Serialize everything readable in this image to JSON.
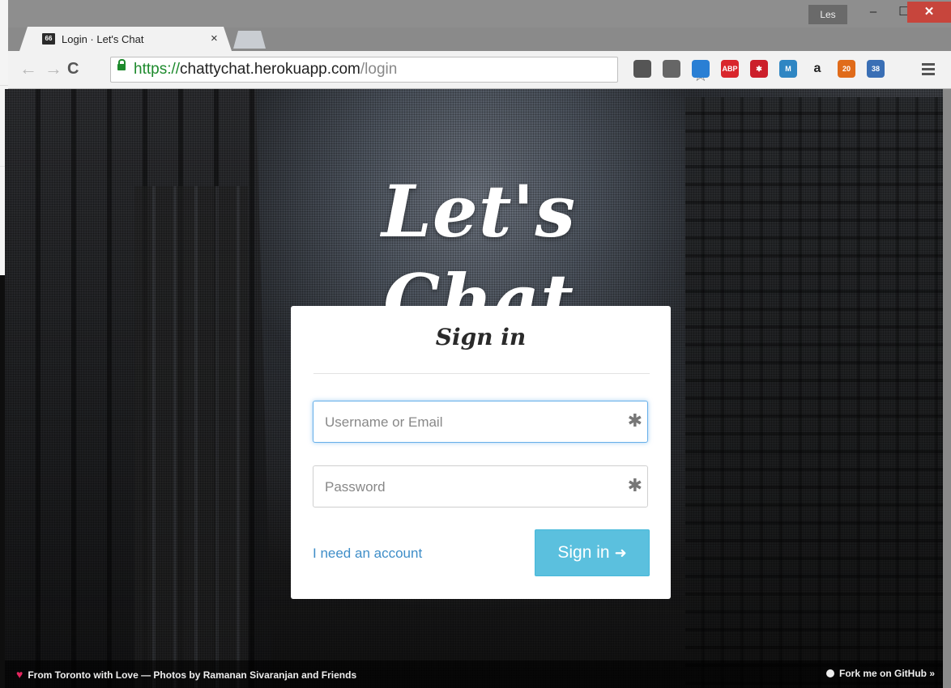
{
  "browser": {
    "tab_title": "Login · Let's Chat",
    "tab_favicon_text": "66",
    "profile_name": "Les",
    "url_scheme": "https://",
    "url_host": "chattychat.herokuapp.com",
    "url_path": "/login",
    "extensions": [
      {
        "name": "pocket-icon",
        "color": "#555555",
        "text": ""
      },
      {
        "name": "pin-icon",
        "color": "#666666",
        "text": ""
      },
      {
        "name": "cast-icon",
        "color": "#2a7fd4",
        "text": ""
      },
      {
        "name": "adblock-icon",
        "color": "#d9262c",
        "text": "ABP"
      },
      {
        "name": "lastpass-icon",
        "color": "#cc1f2b",
        "text": "✱"
      },
      {
        "name": "m-icon",
        "color": "#2f86c3",
        "text": "M"
      },
      {
        "name": "amazon-icon",
        "color": "#f2f2f2",
        "text": "a"
      },
      {
        "name": "badge-20-icon",
        "color": "#e06b1a",
        "text": "20"
      },
      {
        "name": "badge-38-icon",
        "color": "#3a6fb5",
        "text": "38"
      }
    ]
  },
  "page": {
    "logo_text": "Let's Chat",
    "card_title": "Sign in",
    "username_placeholder": "Username or Email",
    "password_placeholder": "Password",
    "account_link": "I need an account",
    "signin_label": "Sign in",
    "footer_left": "From Toronto with Love — Photos by Ramanan Sivaranjan and Friends",
    "footer_right": "Fork me on GitHub »"
  },
  "colors": {
    "accent_pink": "#e5255e",
    "button_blue": "#5bc0de",
    "link_blue": "#3f8ec8"
  }
}
